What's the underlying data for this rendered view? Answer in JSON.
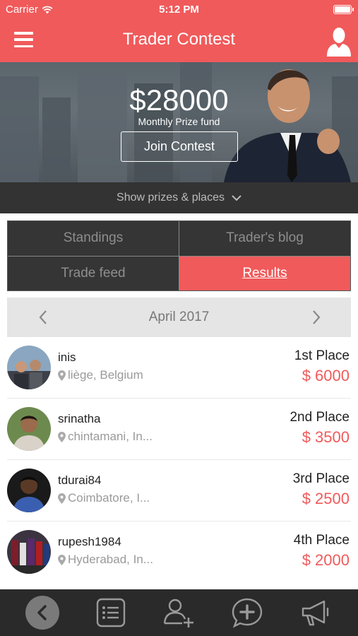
{
  "status_bar": {
    "carrier": "Carrier",
    "time": "5:12 PM"
  },
  "header": {
    "title": "Trader Contest"
  },
  "hero": {
    "amount": "$28000",
    "subtitle": "Monthly Prize fund",
    "join_label": "Join Contest"
  },
  "prizes_toggle": {
    "label": "Show prizes & places"
  },
  "tabs": [
    {
      "label": "Standings",
      "active": false
    },
    {
      "label": "Trader's blog",
      "active": false
    },
    {
      "label": "Trade feed",
      "active": false
    },
    {
      "label": "Results",
      "active": true
    }
  ],
  "month_selector": {
    "label": "April 2017"
  },
  "results": [
    {
      "username": "inis",
      "location": "liège, Belgium",
      "place": "1st Place",
      "prize": "$ 6000"
    },
    {
      "username": "srinatha",
      "location": "chintamani, In...",
      "place": "2nd Place",
      "prize": "$ 3500"
    },
    {
      "username": "tdurai84",
      "location": "Coimbatore, I...",
      "place": "3rd Place",
      "prize": "$ 2500"
    },
    {
      "username": "rupesh1984",
      "location": "Hyderabad, In...",
      "place": "4th Place",
      "prize": "$ 2000"
    }
  ],
  "toolbar": {
    "icons": [
      "back-icon",
      "list-icon",
      "add-user-icon",
      "add-chat-icon",
      "megaphone-icon"
    ]
  },
  "colors": {
    "accent": "#f05a5b",
    "dark": "#333333",
    "toolbar": "#2a2a2a"
  }
}
